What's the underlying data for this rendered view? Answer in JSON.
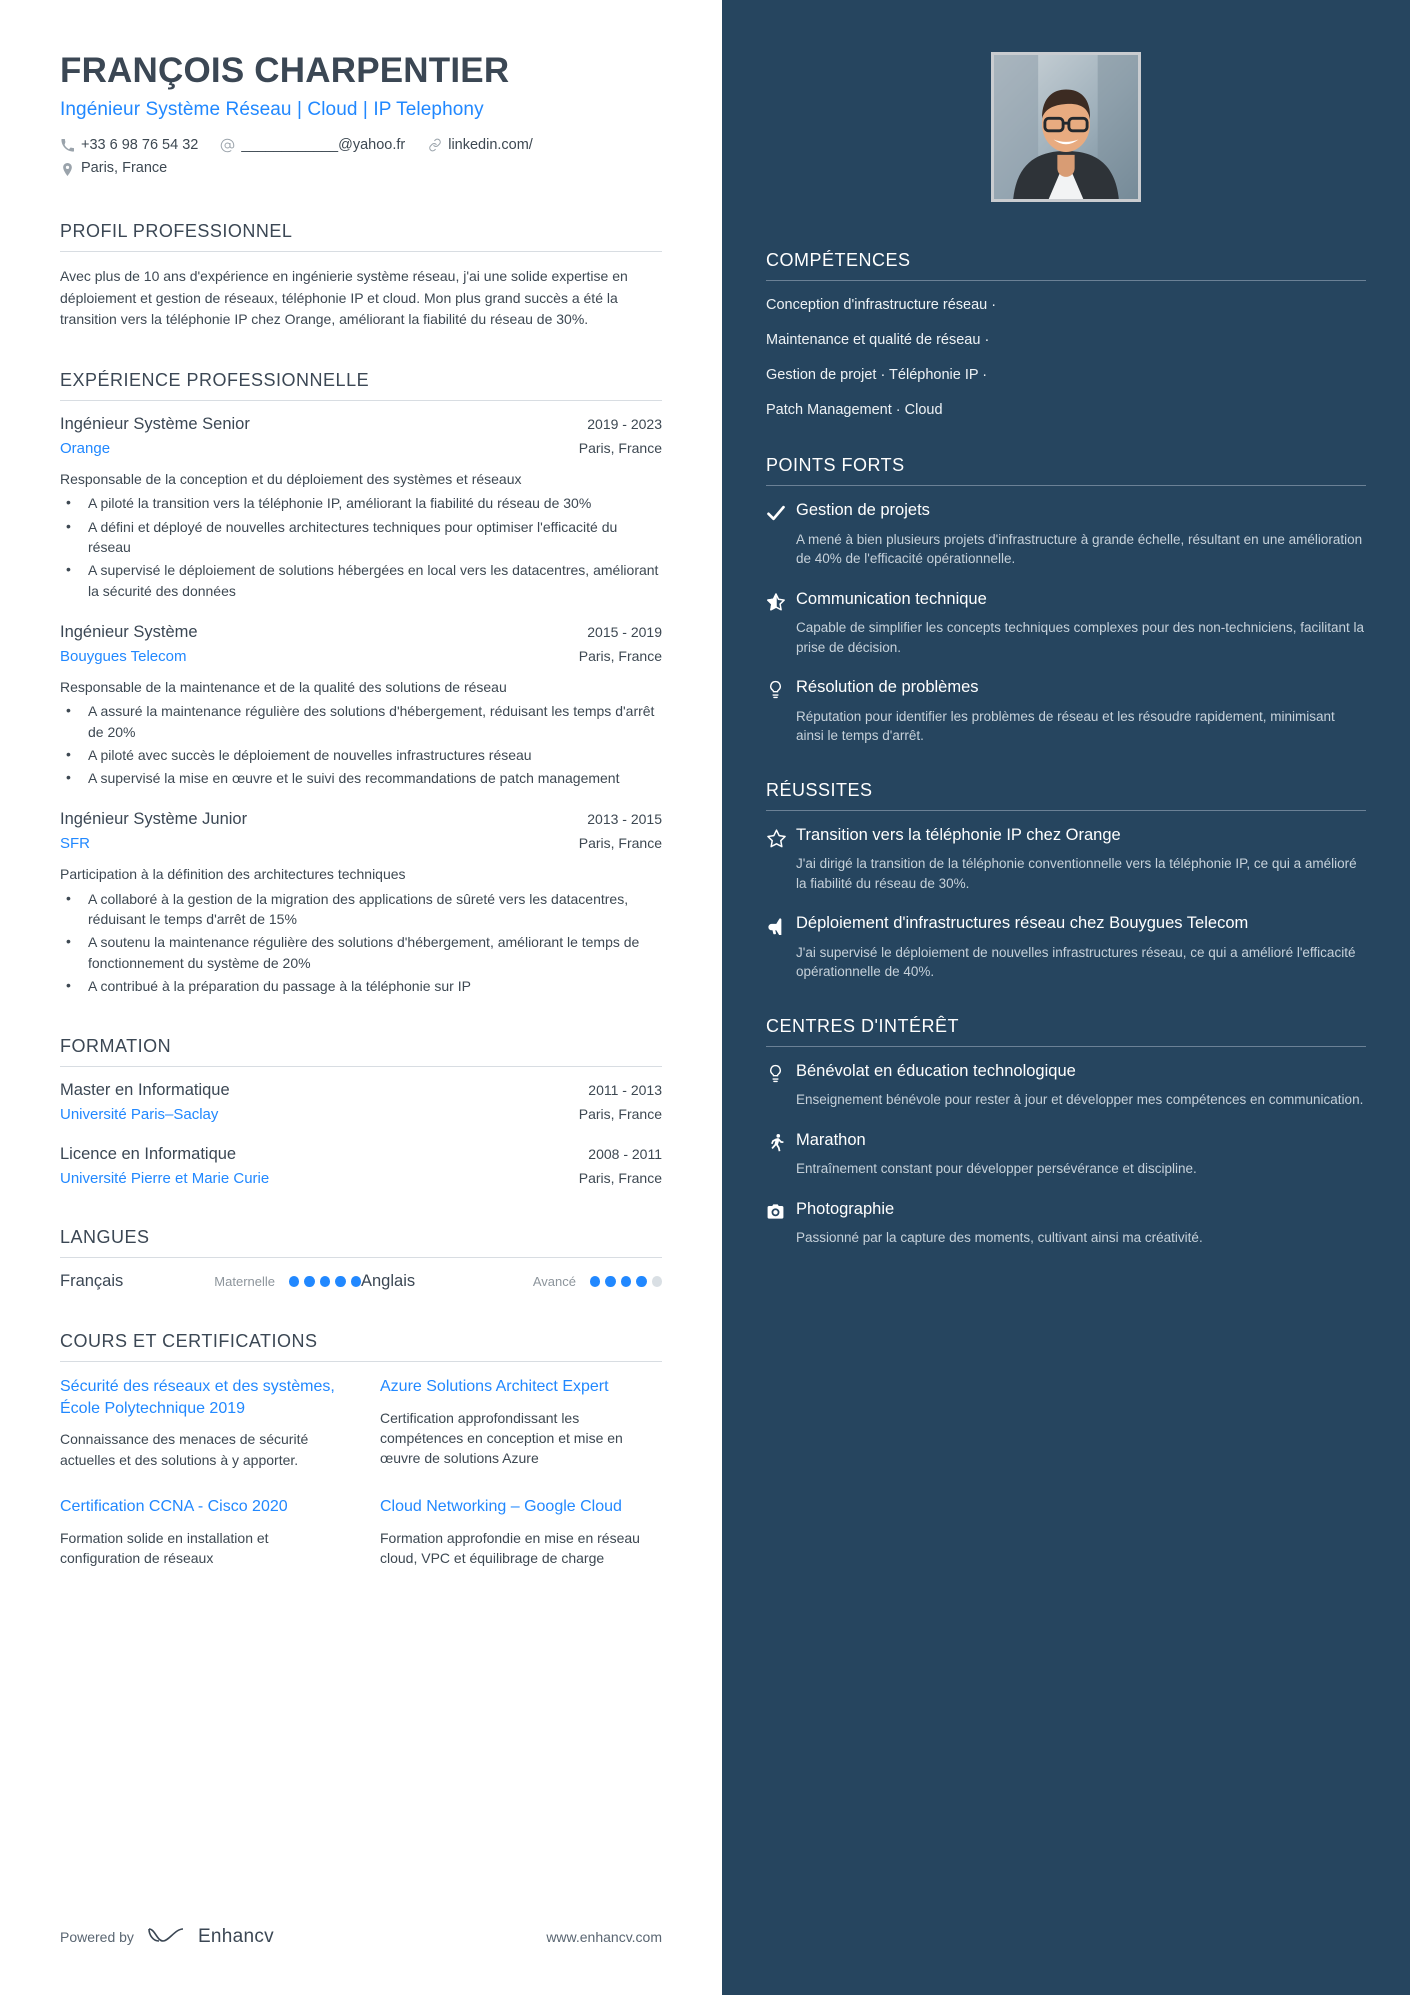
{
  "header": {
    "name": "FRANÇOIS CHARPENTIER",
    "headline": "Ingénieur Système Réseau | Cloud | IP Telephony",
    "phone": "+33 6 98 76 54 32",
    "email": "____________@yahoo.fr",
    "linkedin": "linkedin.com/",
    "location": "Paris, France",
    "icons": {
      "phone": "phone-icon",
      "email": "at-icon",
      "link": "link-icon",
      "location": "map-pin-icon"
    }
  },
  "profile": {
    "title": "PROFIL PROFESSIONNEL",
    "text": "Avec plus de 10 ans d'expérience en ingénierie système réseau, j'ai une solide expertise en déploiement et gestion de réseaux, téléphonie IP et cloud. Mon plus grand succès a été la transition vers la téléphonie IP chez Orange, améliorant la fiabilité du réseau de 30%."
  },
  "experience": {
    "title": "EXPÉRIENCE PROFESSIONNELLE",
    "entries": [
      {
        "role": "Ingénieur Système Senior",
        "dates": "2019 - 2023",
        "company": "Orange",
        "location": "Paris, France",
        "summary": "Responsable de la conception et du déploiement des systèmes et réseaux",
        "bullets": [
          "A piloté la transition vers la téléphonie IP, améliorant la fiabilité du réseau de 30%",
          "A défini et déployé de nouvelles architectures techniques pour optimiser l'efficacité du réseau",
          "A supervisé le déploiement de solutions hébergées en local vers les datacentres, améliorant la sécurité des données"
        ]
      },
      {
        "role": "Ingénieur Système",
        "dates": "2015 - 2019",
        "company": "Bouygues Telecom",
        "location": "Paris, France",
        "summary": "Responsable de la maintenance et de la qualité des solutions de réseau",
        "bullets": [
          "A assuré la maintenance régulière des solutions d'hébergement, réduisant les temps d'arrêt de 20%",
          "A piloté avec succès le déploiement de nouvelles infrastructures réseau",
          "A supervisé la mise en œuvre et le suivi des recommandations de patch management"
        ]
      },
      {
        "role": "Ingénieur Système Junior",
        "dates": "2013 - 2015",
        "company": "SFR",
        "location": "Paris, France",
        "summary": "Participation à la définition des architectures techniques",
        "bullets": [
          "A collaboré à la gestion de la migration des applications de sûreté vers les datacentres, réduisant le temps d'arrêt de 15%",
          "A soutenu la maintenance régulière des solutions d'hébergement, améliorant le temps de fonctionnement du système de 20%",
          "A contribué à la préparation du passage à la téléphonie sur IP"
        ]
      }
    ]
  },
  "education": {
    "title": "FORMATION",
    "entries": [
      {
        "degree": "Master en Informatique",
        "dates": "2011 - 2013",
        "school": "Université Paris–Saclay",
        "location": "Paris, France"
      },
      {
        "degree": "Licence en Informatique",
        "dates": "2008 - 2011",
        "school": "Université Pierre et Marie Curie",
        "location": "Paris, France"
      }
    ]
  },
  "languages": {
    "title": "LANGUES",
    "items": [
      {
        "name": "Français",
        "level": "Maternelle",
        "filled": 5,
        "total": 5
      },
      {
        "name": "Anglais",
        "level": "Avancé",
        "filled": 4,
        "total": 5
      }
    ]
  },
  "courses": {
    "title": "COURS ET CERTIFICATIONS",
    "items": [
      {
        "name": "Sécurité des réseaux et des systèmes, École Polytechnique 2019",
        "desc": "Connaissance des menaces de sécurité actuelles et des solutions à y apporter."
      },
      {
        "name": "Azure Solutions Architect Expert",
        "desc": "Certification approfondissant les compétences en conception et mise en œuvre de solutions Azure"
      },
      {
        "name": "Certification CCNA - Cisco 2020",
        "desc": "Formation solide en installation et configuration de réseaux"
      },
      {
        "name": "Cloud Networking – Google Cloud",
        "desc": "Formation approfondie en mise en réseau cloud, VPC et équilibrage de charge"
      }
    ]
  },
  "footer": {
    "powered_by": "Powered by",
    "brand": "Enhancv",
    "website": "www.enhancv.com"
  },
  "sidebar": {
    "skills": {
      "title": "COMPÉTENCES",
      "lines": [
        "Conception d'infrastructure réseau ·",
        "Maintenance et qualité de réseau ·",
        "Gestion de projet · Téléphonie IP ·",
        "Patch Management · Cloud"
      ]
    },
    "strengths": {
      "title": "POINTS FORTS",
      "items": [
        {
          "icon": "check-icon",
          "title": "Gestion de projets",
          "desc": "A mené à bien plusieurs projets d'infrastructure à grande échelle, résultant en une amélioration de 40% de l'efficacité opérationnelle."
        },
        {
          "icon": "star-half-icon",
          "title": "Communication technique",
          "desc": "Capable de simplifier les concepts techniques complexes pour des non-techniciens, facilitant la prise de décision."
        },
        {
          "icon": "lightbulb-icon",
          "title": "Résolution de problèmes",
          "desc": "Réputation pour identifier les problèmes de réseau et les résoudre rapidement, minimisant ainsi le temps d'arrêt."
        }
      ]
    },
    "achievements": {
      "title": "RÉUSSITES",
      "items": [
        {
          "icon": "star-outline-icon",
          "title": "Transition vers la téléphonie IP chez Orange",
          "desc": "J'ai dirigé la transition de la téléphonie conventionnelle vers la téléphonie IP, ce qui a amélioré la fiabilité du réseau de 30%."
        },
        {
          "icon": "megaphone-icon",
          "title": "Déploiement d'infrastructures réseau chez Bouygues Telecom",
          "desc": "J'ai supervisé le déploiement de nouvelles infrastructures réseau, ce qui a amélioré l'efficacité opérationnelle de 40%."
        }
      ]
    },
    "interests": {
      "title": "CENTRES D'INTÉRÊT",
      "items": [
        {
          "icon": "lightbulb-icon",
          "title": "Bénévolat en éducation technologique",
          "desc": "Enseignement bénévole pour rester à jour et développer mes compétences en communication."
        },
        {
          "icon": "runner-icon",
          "title": "Marathon",
          "desc": "Entraînement constant pour développer persévérance et discipline."
        },
        {
          "icon": "camera-icon",
          "title": "Photographie",
          "desc": "Passionné par la capture des moments, cultivant ainsi ma créativité."
        }
      ]
    }
  },
  "colors": {
    "accent": "#2188ff",
    "sidebar_bg": "#26455f",
    "text": "#3d4852"
  }
}
